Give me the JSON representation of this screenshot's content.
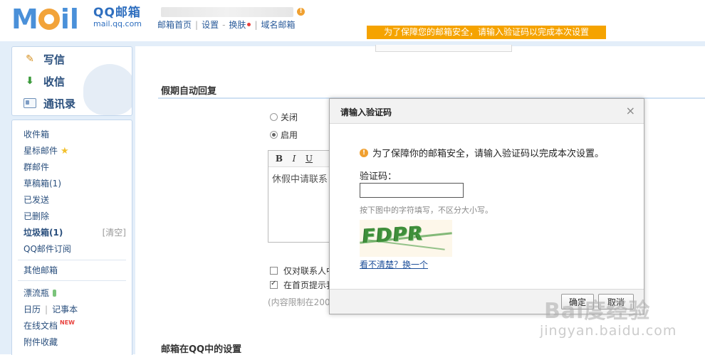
{
  "header": {
    "logo_cn": "QQ邮箱",
    "logo_url": "mail.qq.com",
    "nav": [
      "邮箱首页",
      "设置",
      "换肤",
      "域名邮箱"
    ],
    "nav_dash": "-",
    "notice": "为了保障您的邮箱安全，请输入验证码以完成本次设置"
  },
  "sidebar": {
    "quick": [
      "写信",
      "收信",
      "通讯录"
    ],
    "folders": {
      "inbox": "收件箱",
      "starred": "星标邮件",
      "group": "群邮件",
      "drafts": "草稿箱(1)",
      "sent": "已发送",
      "deleted": "已删除",
      "spam": "垃圾箱(1)",
      "spam_clear": "[清空]",
      "subscribe": "QQ邮件订阅",
      "other": "其他邮箱",
      "bottle": "漂流瓶",
      "calendar": "日历",
      "notes": "记事本",
      "docs": "在线文档",
      "docs_badge": "NEW",
      "attach": "附件收藏"
    }
  },
  "main": {
    "vacation_title": "假期自动回复",
    "radio_off": "关闭",
    "radio_on": "启用",
    "toolbar": [
      "B",
      "I",
      "U"
    ],
    "editor_text": "休假中请联系",
    "check1": "仅对联系人中",
    "check2": "在首页提示我",
    "limit_hint": "(内容限制在200",
    "qq_section": "邮箱在QQ中的设置"
  },
  "dialog": {
    "title": "请输入验证码",
    "close": "×",
    "warning": "为了保障你的邮箱安全，请输入验证码以完成本次设置。",
    "label": "验证码：",
    "input_value": "",
    "tip": "按下图中的字符填写，不区分大小写。",
    "captcha": "FDPR",
    "refresh": "看不清楚？换一个",
    "ok": "确定",
    "cancel": "取消"
  },
  "watermark": {
    "main": "Bai度经验",
    "sub": "jingyan.baidu.com"
  }
}
